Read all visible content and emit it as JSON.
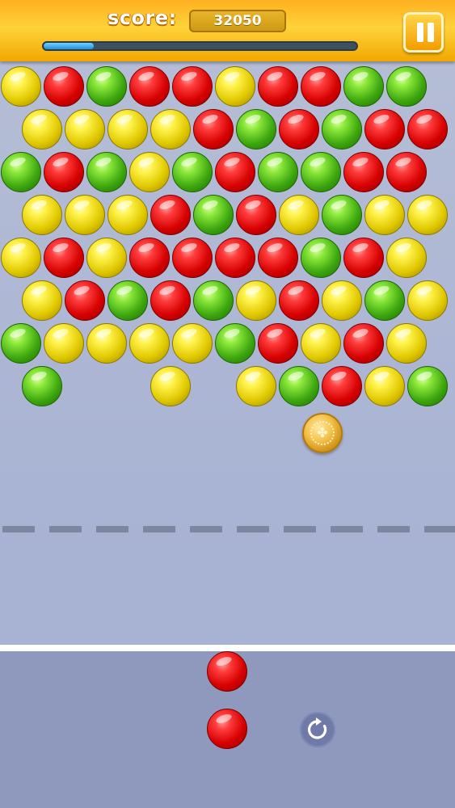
{
  "hud": {
    "score_label": "score:",
    "score_value": "32050",
    "level_progress": 0.16,
    "pause_icon": "pause-icon"
  },
  "colors": {
    "red": "#e00000",
    "green": "#45b513",
    "yellow": "#f2dc00",
    "topbar": "#ffc400",
    "background": "#aeb7d4",
    "shooter_area": "#8f99bd"
  },
  "grid": {
    "rows": [
      [
        "yellow",
        "red",
        "green",
        "red",
        "red",
        "yellow",
        "red",
        "red",
        "green",
        "green"
      ],
      [
        "yellow",
        "yellow",
        "yellow",
        "yellow",
        "red",
        "green",
        "red",
        "green",
        "red",
        "red"
      ],
      [
        "green",
        "red",
        "green",
        "yellow",
        "green",
        "red",
        "green",
        "green",
        "red",
        "red"
      ],
      [
        "yellow",
        "yellow",
        "yellow",
        "red",
        "green",
        "red",
        "yellow",
        "green",
        "yellow",
        "yellow"
      ],
      [
        "yellow",
        "red",
        "yellow",
        "red",
        "red",
        "red",
        "red",
        "green",
        "red",
        "yellow"
      ],
      [
        "yellow",
        "red",
        "green",
        "red",
        "green",
        "yellow",
        "red",
        "yellow",
        "green",
        "yellow"
      ],
      [
        "green",
        "yellow",
        "yellow",
        "yellow",
        "yellow",
        "green",
        "red",
        "yellow",
        "red",
        "yellow"
      ],
      [
        "green",
        null,
        null,
        "yellow",
        null,
        "yellow",
        "green",
        "red",
        "yellow",
        "green"
      ]
    ]
  },
  "bonus_coin": {
    "icon": "clover-coin-icon",
    "glyph": "✤"
  },
  "shooter": {
    "next_bubble": "red",
    "current_bubble": "red",
    "swap_icon": "refresh-icon",
    "swap_glyph": "↻"
  }
}
